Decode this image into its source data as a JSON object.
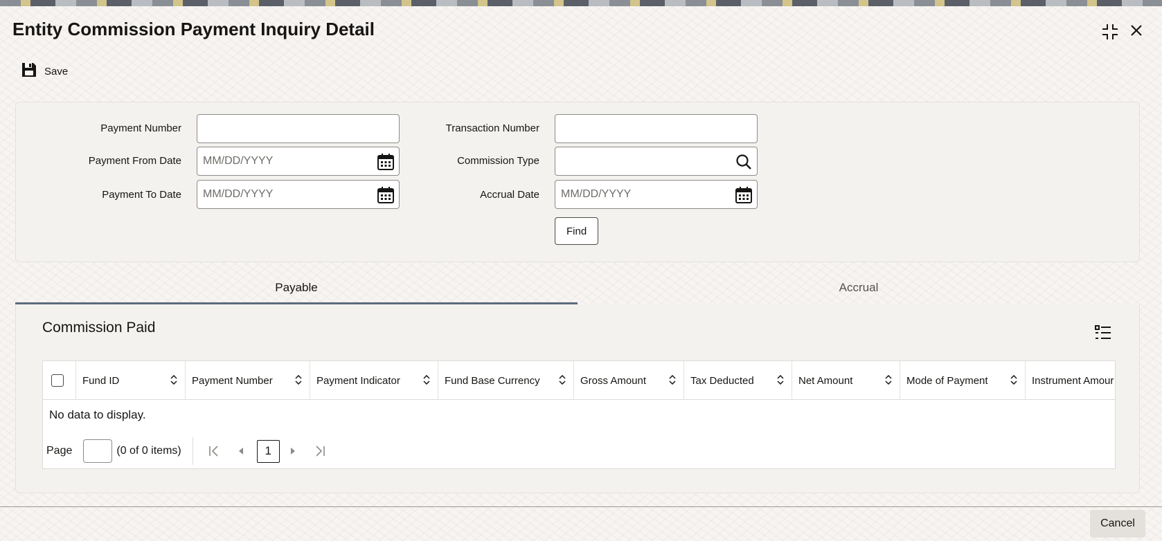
{
  "window": {
    "title": "Entity Commission Payment Inquiry Detail",
    "maximize_icon": "maximize-icon",
    "close_icon": "close-icon"
  },
  "toolbar": {
    "save_label": "Save",
    "save_icon": "save-disk-icon"
  },
  "search": {
    "payment_number_label": "Payment Number",
    "payment_number_value": "",
    "payment_from_date_label": "Payment From Date",
    "payment_from_date_placeholder": "MM/DD/YYYY",
    "payment_to_date_label": "Payment To Date",
    "payment_to_date_placeholder": "MM/DD/YYYY",
    "transaction_number_label": "Transaction Number",
    "transaction_number_value": "",
    "commission_type_label": "Commission Type",
    "commission_type_value": "",
    "accrual_date_label": "Accrual Date",
    "accrual_date_placeholder": "MM/DD/YYYY",
    "find_label": "Find"
  },
  "tabs": [
    {
      "label": "Payable",
      "active": true
    },
    {
      "label": "Accrual",
      "active": false
    }
  ],
  "commission_paid": {
    "title": "Commission Paid",
    "columns": [
      "Fund ID",
      "Payment Number",
      "Payment Indicator",
      "Fund Base Currency",
      "Gross Amount",
      "Tax Deducted",
      "Net Amount",
      "Mode of Payment",
      "Instrument Amour"
    ],
    "empty_message": "No data to display.",
    "pager": {
      "page_label": "Page",
      "page_value": "",
      "count_text": "(0 of 0 items)",
      "current_page": "1"
    }
  },
  "footer": {
    "cancel_label": "Cancel"
  }
}
